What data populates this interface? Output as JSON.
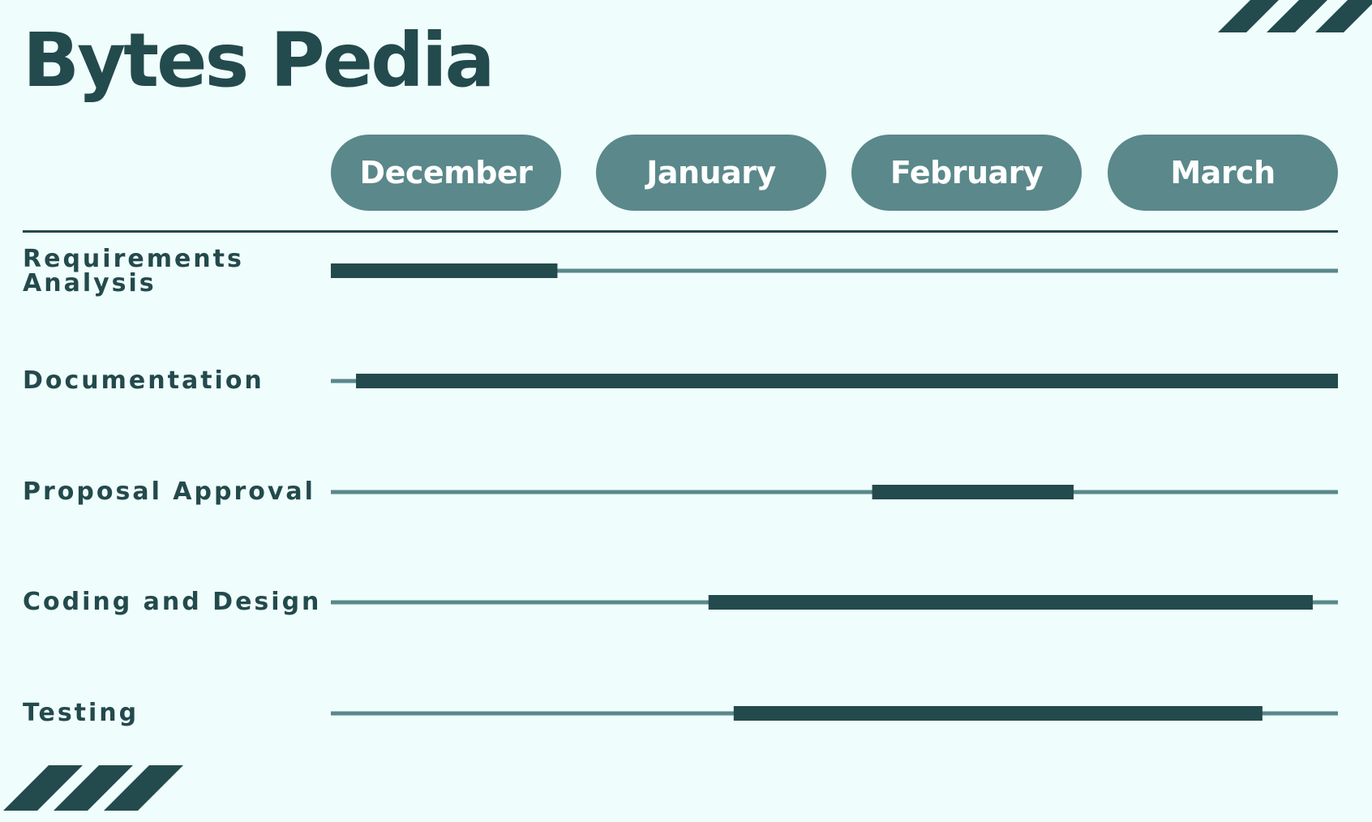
{
  "title": "Bytes Pedia",
  "colors": {
    "background": "#f0fdfd",
    "dark": "#234a4c",
    "accent": "#5a888b",
    "pill_text": "#ffffff"
  },
  "chart_data": {
    "type": "gantt",
    "title": "Bytes Pedia",
    "categories": [
      "December",
      "January",
      "February",
      "March"
    ],
    "xlim": [
      0,
      4
    ],
    "tasks": [
      {
        "label": "Requirements Analysis",
        "start": 0.0,
        "end": 0.9
      },
      {
        "label": "Documentation",
        "start": 0.1,
        "end": 4.0
      },
      {
        "label": "Proposal Approval",
        "start": 2.15,
        "end": 2.95
      },
      {
        "label": "Coding and Design",
        "start": 1.5,
        "end": 3.9
      },
      {
        "label": "Testing",
        "start": 1.6,
        "end": 3.7
      }
    ]
  }
}
